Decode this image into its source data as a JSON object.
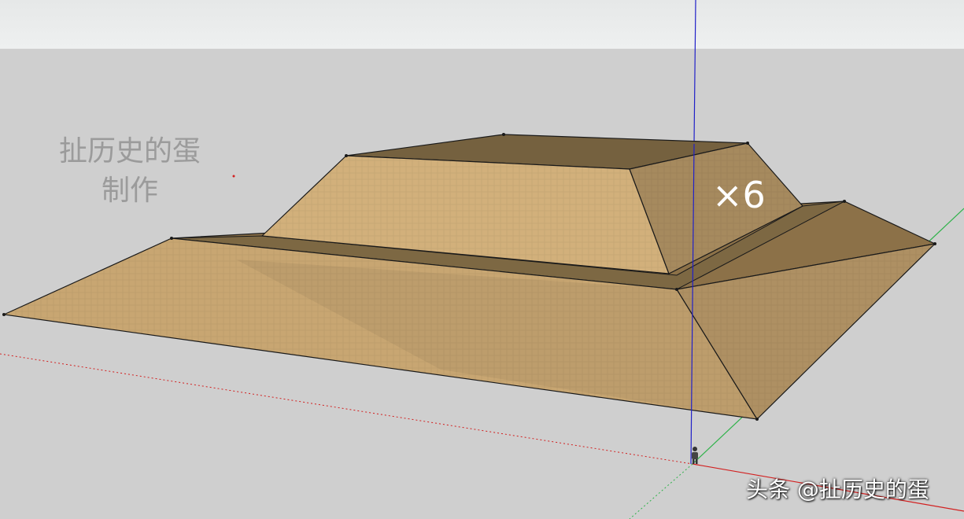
{
  "viewport": {
    "sky_color": "#eceeee",
    "ground_color": "#cfcfcf"
  },
  "axes": {
    "red_axis_color": "#d22020",
    "green_axis_color": "#2fb24a",
    "blue_axis_color": "#2020c8",
    "axes_visible": true
  },
  "model": {
    "tiers": 2,
    "material_color": "#c8a672",
    "shadow_color": "#75613f",
    "edge_color": "#1a1a1a"
  },
  "overlay": {
    "watermark_line1": "扯历史的蛋",
    "watermark_line2": "制作",
    "multiplier": "×6",
    "credit": "头条 @扯历史的蛋"
  },
  "icons": {
    "origin": "person-figure-icon"
  }
}
